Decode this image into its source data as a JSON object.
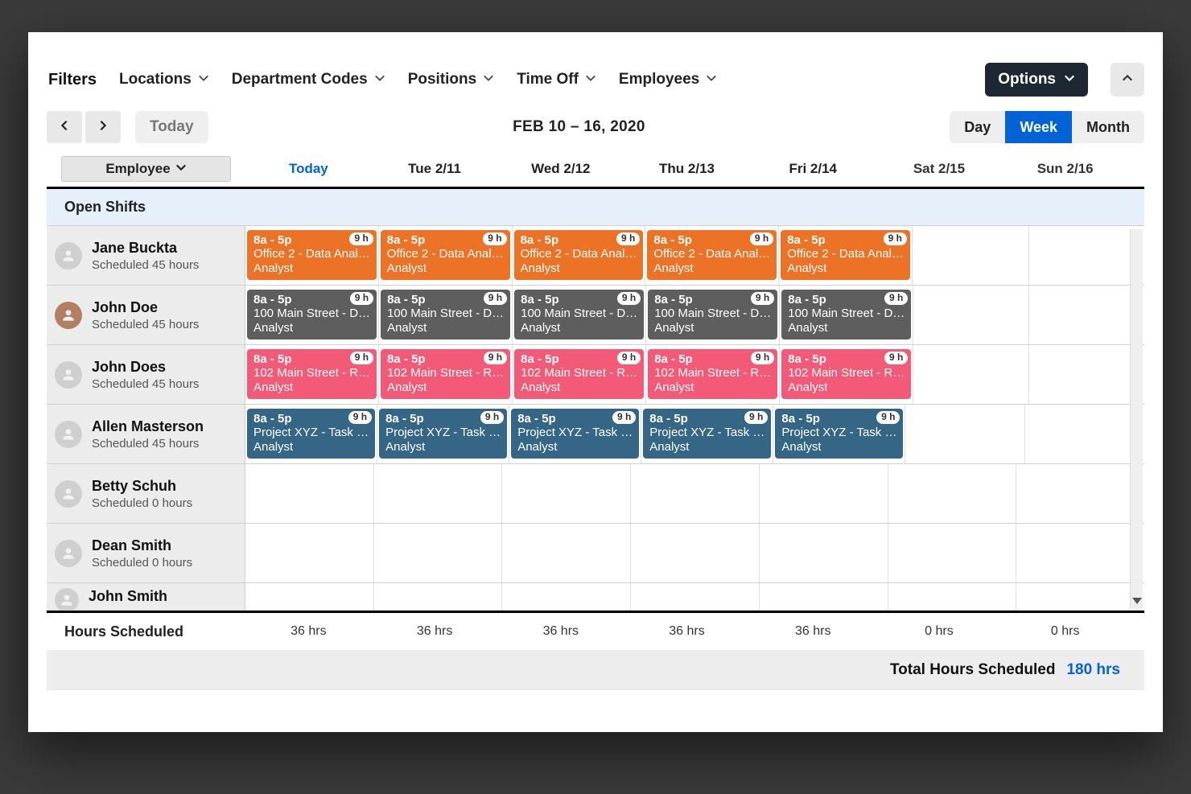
{
  "filters": {
    "label": "Filters",
    "items": [
      "Locations",
      "Department Codes",
      "Positions",
      "Time Off",
      "Employees"
    ]
  },
  "options_label": "Options",
  "today_label": "Today",
  "date_range": "FEB 10 – 16, 2020",
  "periods": {
    "day": "Day",
    "week": "Week",
    "month": "Month",
    "active": "week"
  },
  "employee_col_label": "Employee",
  "days": [
    {
      "label": "Today",
      "is_today": true
    },
    {
      "label": "Tue 2/11"
    },
    {
      "label": "Wed 2/12"
    },
    {
      "label": "Thu 2/13"
    },
    {
      "label": "Fri 2/14"
    },
    {
      "label": "Sat 2/15"
    },
    {
      "label": "Sun 2/16"
    }
  ],
  "open_shifts_label": "Open Shifts",
  "shift_hours_badge": "9 h",
  "shift_time": "8a - 5p",
  "shift_role": "Analyst",
  "locations": {
    "orange": "Office 2 - Data Anal…",
    "gray": "100 Main Street - D…",
    "pink": "102 Main Street - R…",
    "teal": "Project XYZ - Task …"
  },
  "employees": [
    {
      "name": "Jane Buckta",
      "sched": "Scheduled 45 hours",
      "color": "orange",
      "shifts": 5
    },
    {
      "name": "John Doe",
      "sched": "Scheduled 45 hours",
      "color": "gray",
      "shifts": 5,
      "photo": true
    },
    {
      "name": "John Does",
      "sched": "Scheduled 45 hours",
      "color": "pink",
      "shifts": 5
    },
    {
      "name": "Allen Masterson",
      "sched": "Scheduled 45 hours",
      "color": "teal",
      "shifts": 5
    },
    {
      "name": "Betty Schuh",
      "sched": "Scheduled 0 hours",
      "color": null,
      "shifts": 0
    },
    {
      "name": "Dean Smith",
      "sched": "Scheduled 0 hours",
      "color": null,
      "shifts": 0
    },
    {
      "name": "John Smith",
      "sched": "",
      "color": null,
      "shifts": 0,
      "cut": true
    }
  ],
  "hours_row": {
    "label": "Hours Scheduled",
    "values": [
      "36 hrs",
      "36 hrs",
      "36 hrs",
      "36 hrs",
      "36 hrs",
      "0 hrs",
      "0 hrs"
    ]
  },
  "total": {
    "label": "Total Hours Scheduled",
    "value": "180 hrs"
  }
}
